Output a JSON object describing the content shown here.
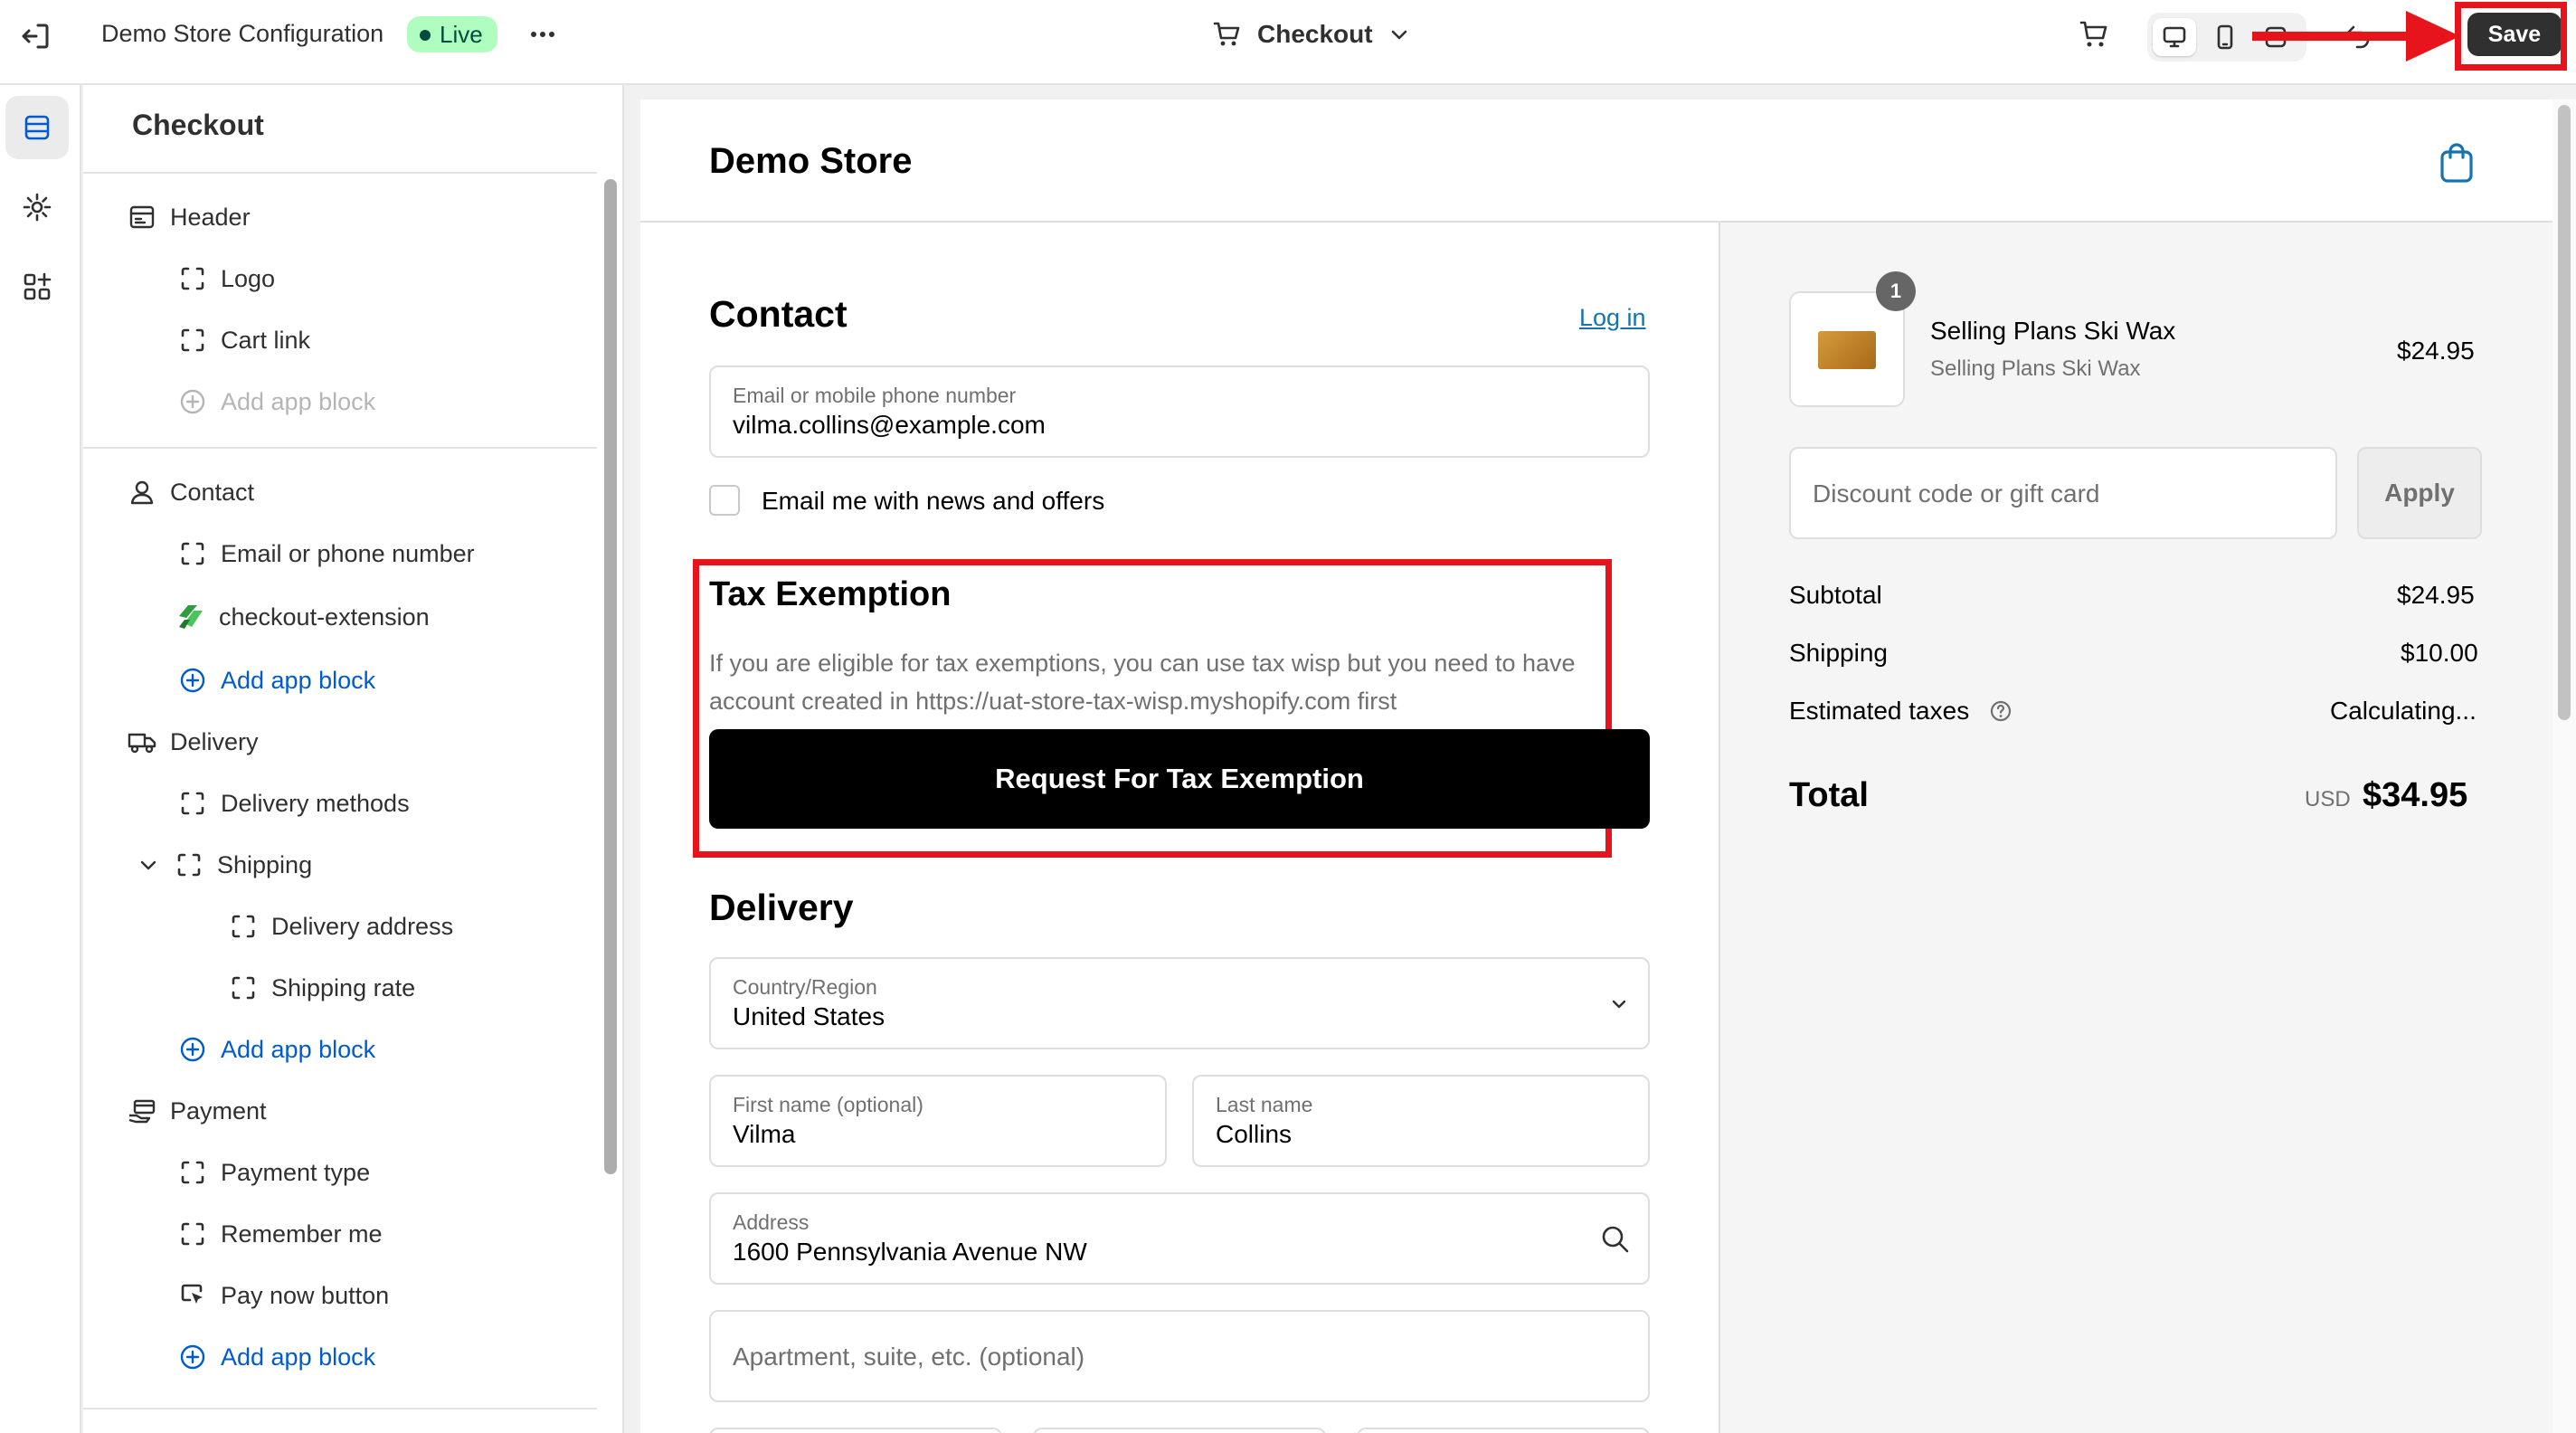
{
  "topbar": {
    "title": "Demo Store Configuration",
    "status": "Live",
    "page_selector": "Checkout",
    "save_label": "Save"
  },
  "sidebar": {
    "title": "Checkout",
    "items": [
      {
        "label": "Header",
        "icon": "header-layout-icon"
      },
      {
        "label": "Logo",
        "icon": "block-icon"
      },
      {
        "label": "Cart link",
        "icon": "block-icon"
      },
      {
        "label": "Add app block",
        "icon": "add-circle-icon",
        "state": "disabled"
      },
      {
        "label": "Contact",
        "icon": "person-icon"
      },
      {
        "label": "Email or phone number",
        "icon": "block-icon"
      },
      {
        "label": "checkout-extension",
        "icon": "app-extension-icon"
      },
      {
        "label": "Add app block",
        "icon": "add-circle-icon"
      },
      {
        "label": "Delivery",
        "icon": "truck-icon"
      },
      {
        "label": "Delivery methods",
        "icon": "block-icon"
      },
      {
        "label": "Shipping",
        "icon": "block-icon"
      },
      {
        "label": "Delivery address",
        "icon": "block-icon"
      },
      {
        "label": "Shipping rate",
        "icon": "block-icon"
      },
      {
        "label": "Add app block",
        "icon": "add-circle-icon"
      },
      {
        "label": "Payment",
        "icon": "payment-hand-icon"
      },
      {
        "label": "Payment type",
        "icon": "block-icon"
      },
      {
        "label": "Remember me",
        "icon": "block-icon"
      },
      {
        "label": "Pay now button",
        "icon": "cursor-click-icon"
      },
      {
        "label": "Add app block",
        "icon": "add-circle-icon"
      }
    ]
  },
  "preview": {
    "store_name": "Demo Store",
    "contact": {
      "heading": "Contact",
      "login_link": "Log in",
      "email_label": "Email or mobile phone number",
      "email_value": "vilma.collins@example.com",
      "newsletter_label": "Email me with news and offers"
    },
    "tax": {
      "heading": "Tax Exemption",
      "description_line1": "If you are eligible for tax exemptions, you can use tax wisp but you need to have",
      "description_line2": "account created in https://uat-store-tax-wisp.myshopify.com first",
      "button_label": "Request For Tax Exemption"
    },
    "delivery": {
      "heading": "Delivery",
      "country_label": "Country/Region",
      "country_value": "United States",
      "first_name_label": "First name (optional)",
      "first_name_value": "Vilma",
      "last_name_label": "Last name",
      "last_name_value": "Collins",
      "address_label": "Address",
      "address_value": "1600 Pennsylvania Avenue NW",
      "apartment_placeholder": "Apartment, suite, etc. (optional)"
    },
    "summary": {
      "quantity": "1",
      "product_name": "Selling Plans Ski Wax",
      "product_variant": "Selling Plans Ski Wax",
      "product_price": "$24.95",
      "discount_placeholder": "Discount code or gift card",
      "apply_label": "Apply",
      "subtotal_label": "Subtotal",
      "subtotal_value": "$24.95",
      "shipping_label": "Shipping",
      "shipping_value": "$10.00",
      "taxes_label": "Estimated taxes",
      "taxes_value": "Calculating...",
      "total_label": "Total",
      "total_currency": "USD",
      "total_value": "$34.95"
    }
  },
  "colors": {
    "highlight": "#e8141b",
    "live_badge_bg": "#affebf",
    "link": "#1773b0",
    "add_block": "#005bd3"
  }
}
